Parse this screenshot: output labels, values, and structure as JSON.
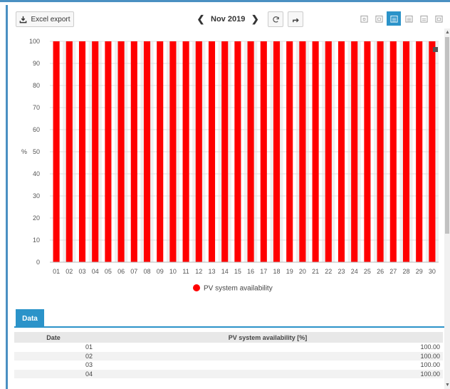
{
  "toolbar": {
    "export_label": "Excel export",
    "period": "Nov 2019",
    "prev": "❮",
    "next": "❯"
  },
  "colors": {
    "accent": "#2b93c9",
    "bar": "#ff0000",
    "frame": "#4a90c2"
  },
  "chart_data": {
    "type": "bar",
    "categories": [
      "01",
      "02",
      "03",
      "04",
      "05",
      "06",
      "07",
      "08",
      "09",
      "10",
      "11",
      "12",
      "13",
      "14",
      "15",
      "16",
      "17",
      "18",
      "19",
      "20",
      "21",
      "22",
      "23",
      "24",
      "25",
      "26",
      "27",
      "28",
      "29",
      "30"
    ],
    "series": [
      {
        "name": "PV system availability",
        "values": [
          100,
          100,
          100,
          100,
          100,
          100,
          100,
          100,
          100,
          100,
          100,
          100,
          100,
          100,
          100,
          100,
          100,
          100,
          100,
          100,
          100,
          100,
          100,
          100,
          100,
          100,
          100,
          100,
          100,
          100
        ]
      }
    ],
    "ylabel": "%",
    "yticks": [
      0,
      10,
      20,
      30,
      40,
      50,
      60,
      70,
      80,
      90,
      100
    ],
    "ylim": [
      0,
      100
    ],
    "grid": true,
    "legend": "bottom"
  },
  "tabs": {
    "data": "Data"
  },
  "table": {
    "headers": [
      "Date",
      "PV system availability [%]"
    ],
    "rows": [
      [
        "01",
        "100.00"
      ],
      [
        "02",
        "100.00"
      ],
      [
        "03",
        "100.00"
      ],
      [
        "04",
        "100.00"
      ]
    ]
  }
}
